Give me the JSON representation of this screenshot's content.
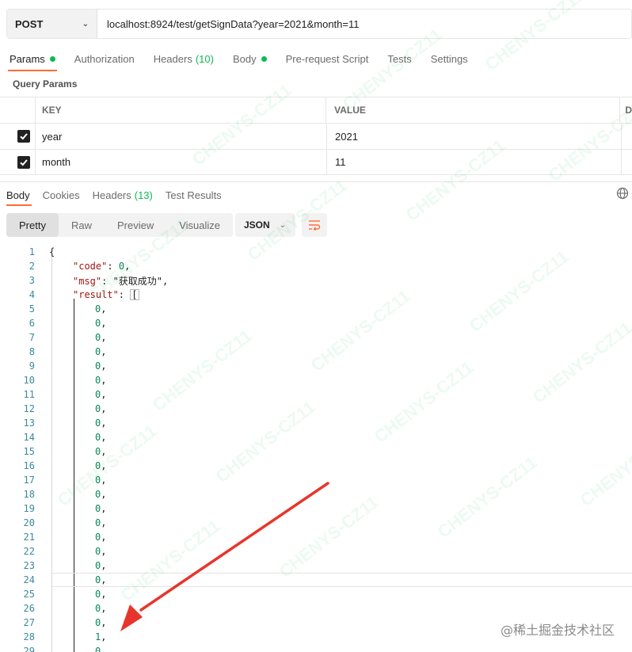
{
  "request": {
    "method": "POST",
    "url": "localhost:8924/test/getSignData?year=2021&month=11"
  },
  "request_tabs": [
    {
      "label": "Params",
      "dot": true,
      "count": ""
    },
    {
      "label": "Authorization",
      "dot": false,
      "count": ""
    },
    {
      "label": "Headers",
      "dot": false,
      "count": "(10)"
    },
    {
      "label": "Body",
      "dot": true,
      "count": ""
    },
    {
      "label": "Pre-request Script",
      "dot": false,
      "count": ""
    },
    {
      "label": "Tests",
      "dot": false,
      "count": ""
    },
    {
      "label": "Settings",
      "dot": false,
      "count": ""
    }
  ],
  "query_params": {
    "title": "Query Params",
    "headers": {
      "key": "KEY",
      "value": "VALUE",
      "desc": "D"
    },
    "rows": [
      {
        "key": "year",
        "value": "2021",
        "checked": true
      },
      {
        "key": "month",
        "value": "11",
        "checked": true
      }
    ]
  },
  "response_tabs": [
    {
      "label": "Body",
      "count": ""
    },
    {
      "label": "Cookies",
      "count": ""
    },
    {
      "label": "Headers",
      "count": "(13)"
    },
    {
      "label": "Test Results",
      "count": ""
    }
  ],
  "view_modes": [
    "Pretty",
    "Raw",
    "Preview",
    "Visualize"
  ],
  "format": "JSON",
  "code_lines": [
    {
      "n": "1",
      "text": "{"
    },
    {
      "n": "2",
      "text": "\"code\": 0,"
    },
    {
      "n": "3",
      "text": "\"msg\": \"获取成功\","
    },
    {
      "n": "4",
      "text": "\"result\": ["
    },
    {
      "n": "5",
      "text": "0,"
    },
    {
      "n": "6",
      "text": "0,"
    },
    {
      "n": "7",
      "text": "0,"
    },
    {
      "n": "8",
      "text": "0,"
    },
    {
      "n": "9",
      "text": "0,"
    },
    {
      "n": "10",
      "text": "0,"
    },
    {
      "n": "11",
      "text": "0,"
    },
    {
      "n": "12",
      "text": "0,"
    },
    {
      "n": "13",
      "text": "0,"
    },
    {
      "n": "14",
      "text": "0,"
    },
    {
      "n": "15",
      "text": "0,"
    },
    {
      "n": "16",
      "text": "0,"
    },
    {
      "n": "17",
      "text": "0,"
    },
    {
      "n": "18",
      "text": "0,"
    },
    {
      "n": "19",
      "text": "0,"
    },
    {
      "n": "20",
      "text": "0,"
    },
    {
      "n": "21",
      "text": "0,"
    },
    {
      "n": "22",
      "text": "0,"
    },
    {
      "n": "23",
      "text": "0,"
    },
    {
      "n": "24",
      "text": "0,"
    },
    {
      "n": "25",
      "text": "0,"
    },
    {
      "n": "26",
      "text": "0,"
    },
    {
      "n": "27",
      "text": "0,"
    },
    {
      "n": "28",
      "text": "1,"
    },
    {
      "n": "29",
      "text": "0"
    }
  ],
  "watermark_text": "CHENYS-CZ11",
  "site_mark": "@稀土掘金技术社区",
  "colors": {
    "accent": "#ff6c37",
    "success": "#0cbb52",
    "arrow": "#e8352b"
  }
}
